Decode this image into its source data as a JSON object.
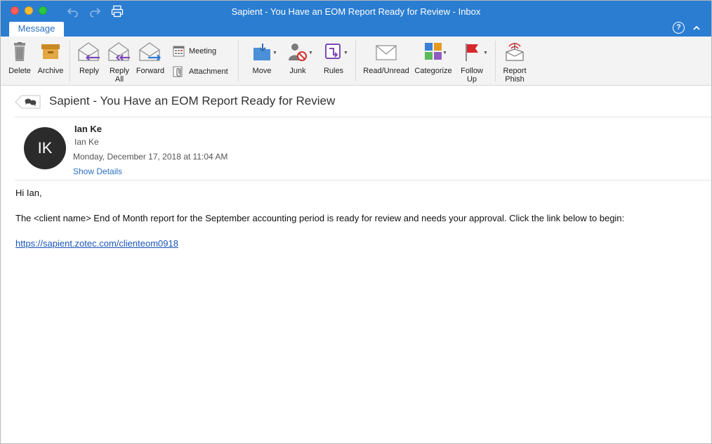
{
  "window": {
    "title": "Sapient - You Have an EOM Report Ready for Review - Inbox"
  },
  "tabs": [
    {
      "label": "Message",
      "active": true
    }
  ],
  "help_label": "?",
  "ribbon": {
    "delete": "Delete",
    "archive": "Archive",
    "reply": "Reply",
    "reply_all_1": "Reply",
    "reply_all_2": "All",
    "forward": "Forward",
    "meeting": "Meeting",
    "attachment": "Attachment",
    "move": "Move",
    "junk": "Junk",
    "rules": "Rules",
    "read_unread": "Read/Unread",
    "categorize": "Categorize",
    "follow_up_1": "Follow",
    "follow_up_2": "Up",
    "report_phish_1": "Report",
    "report_phish_2": "Phish"
  },
  "message": {
    "subject": "Sapient - You Have an EOM Report Ready for Review",
    "avatar_initials": "IK",
    "sender_name": "Ian Ke",
    "sender_sub": "Ian Ke",
    "date": "Monday, December 17, 2018 at 11:04 AM",
    "show_details": "Show Details",
    "greeting": "Hi Ian,",
    "body": "The <client name> End of Month report for the September accounting period is ready for review and needs your approval. Click the link below to begin:",
    "link": "https://sapient.zotec.com/clienteom0918"
  },
  "colors": {
    "titlebar": "#2a7dd1",
    "accent": "#2a6fc1",
    "link": "#1a55b8"
  }
}
